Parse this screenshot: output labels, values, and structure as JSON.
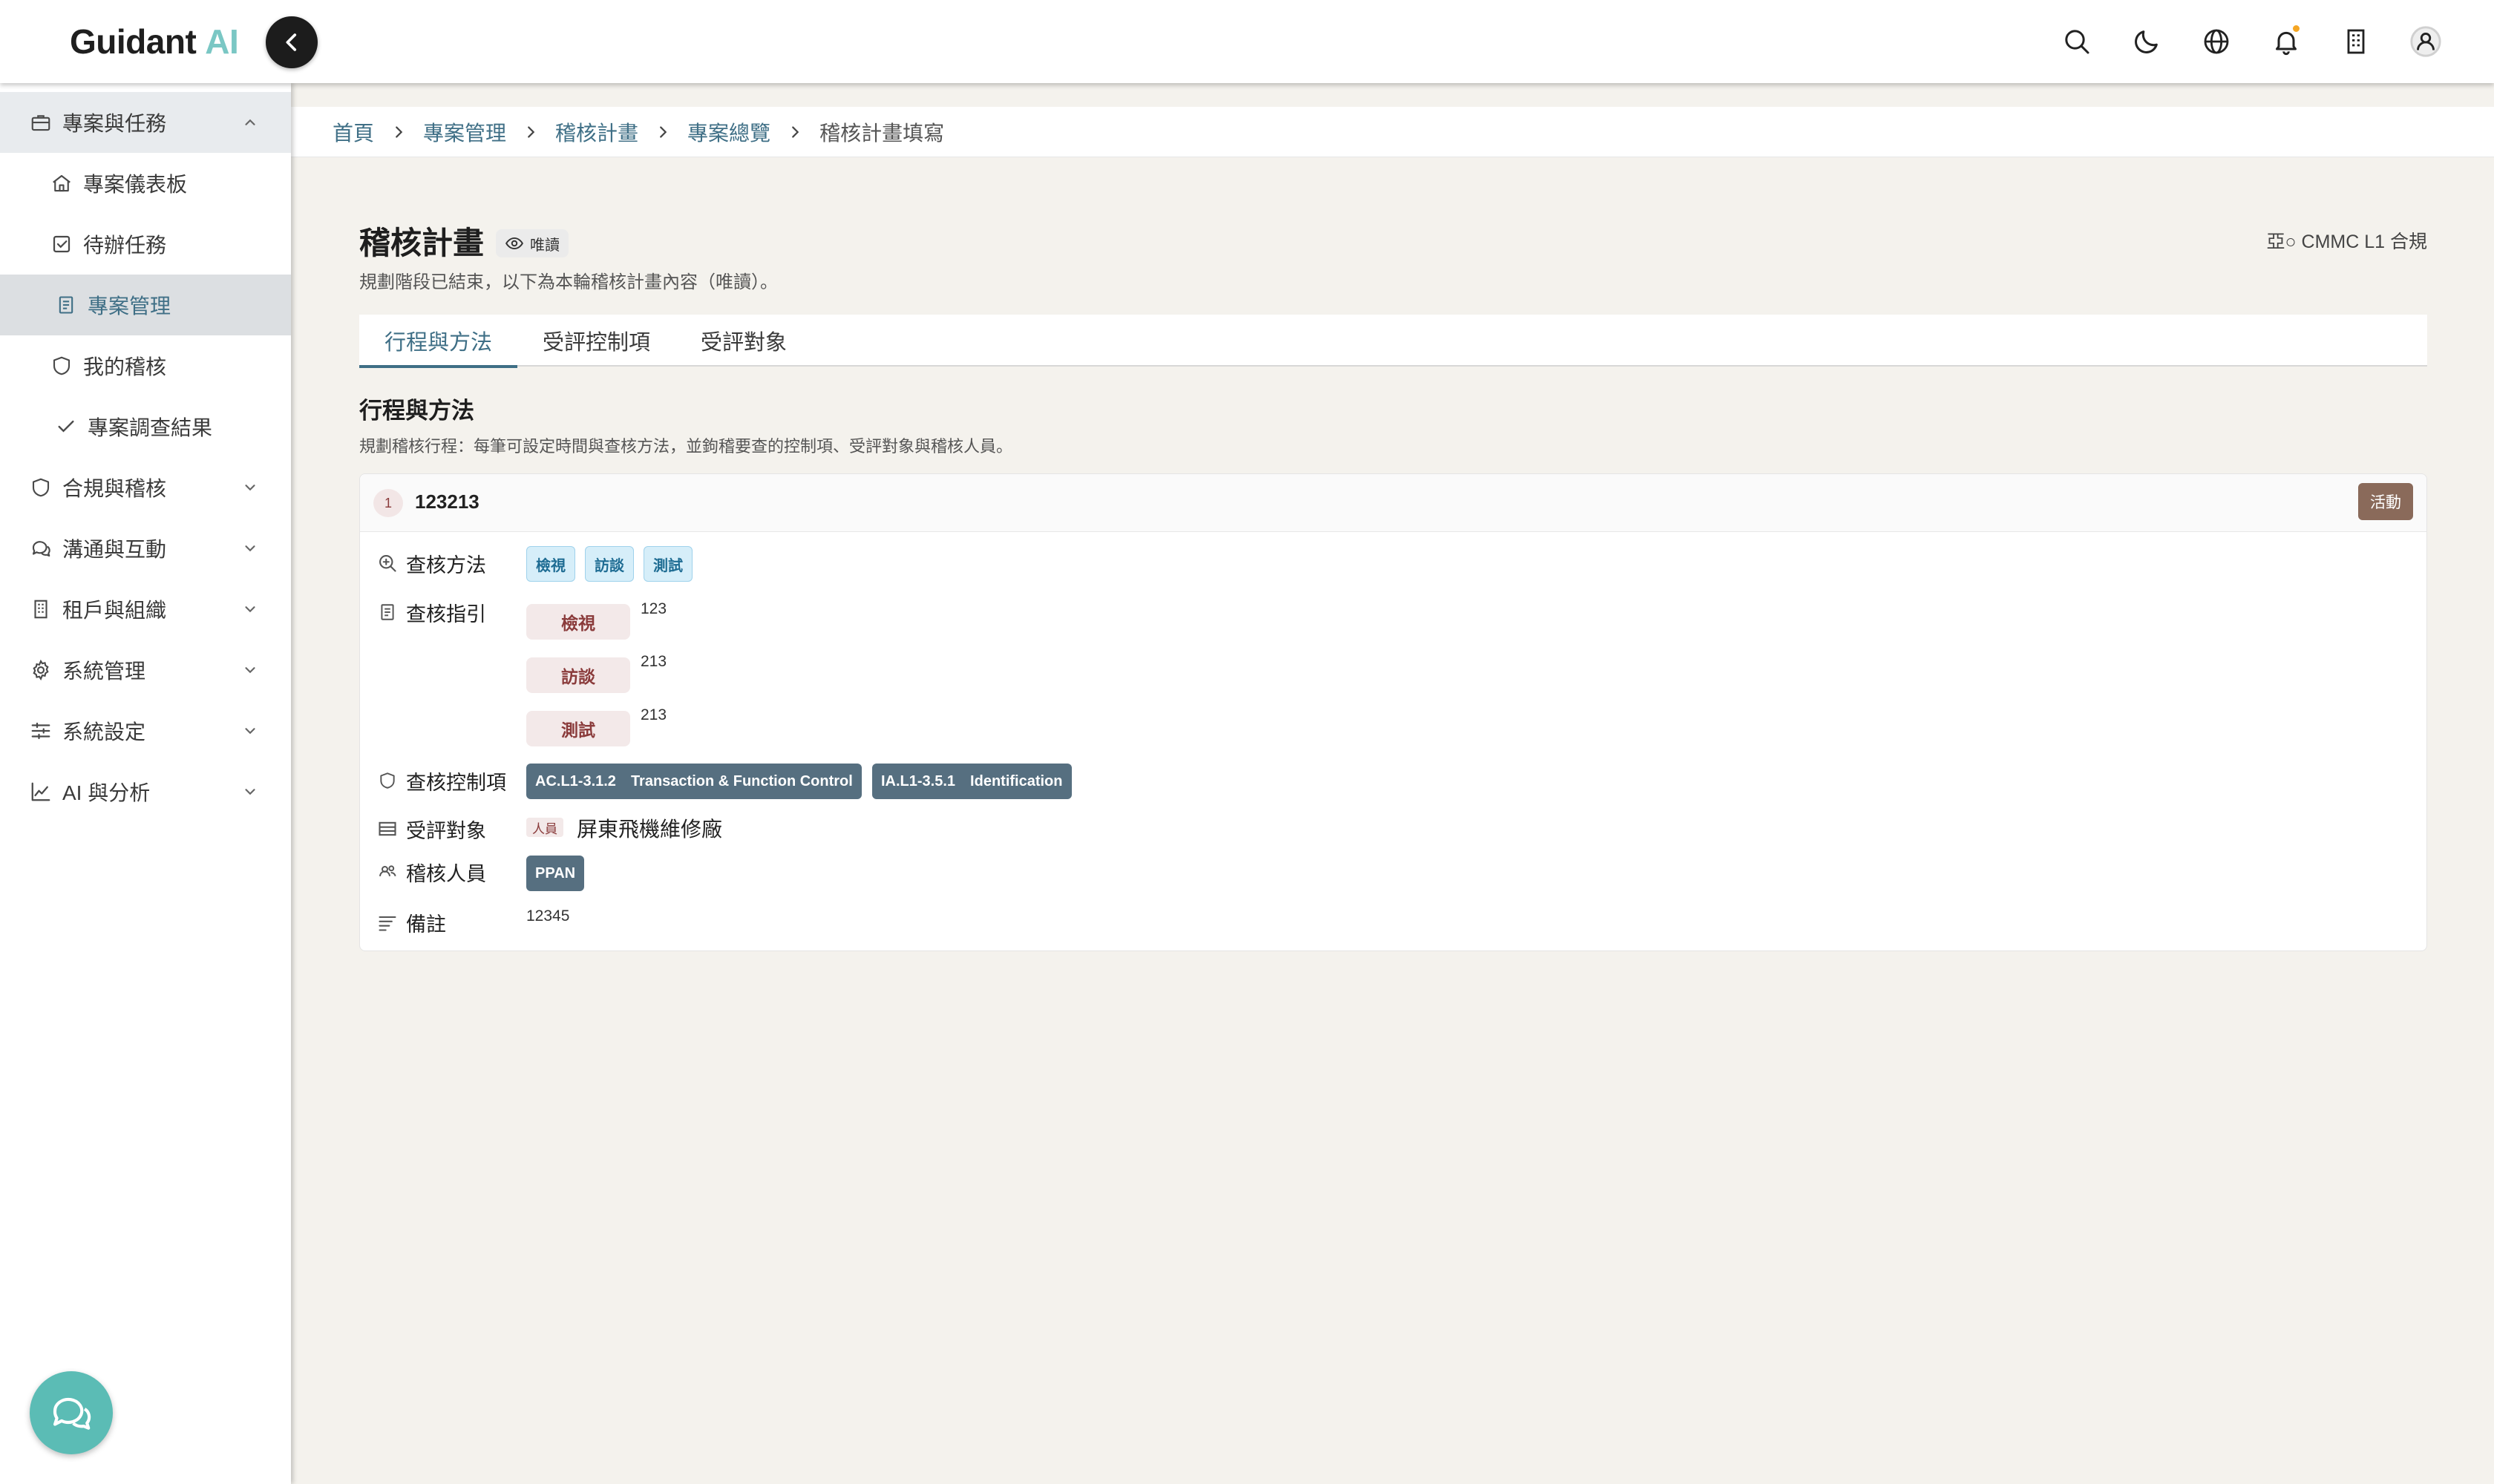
{
  "app": {
    "logo_text": "Guidant",
    "logo_accent": "AI",
    "accent_color": "#7ac7c4"
  },
  "topbar": {
    "icons": [
      "search-icon",
      "moon-icon",
      "globe-icon",
      "bell-icon",
      "building-icon",
      "user-icon"
    ],
    "has_notification": true
  },
  "sidebar": {
    "items": [
      {
        "label": "專案與任務",
        "icon": "briefcase-icon",
        "expanded": true
      },
      {
        "label": "專案儀表板",
        "icon": "home-icon"
      },
      {
        "label": "待辦任務",
        "icon": "checkbox-icon"
      },
      {
        "label": "專案管理",
        "icon": "document-icon",
        "active": true
      },
      {
        "label": "我的稽核",
        "icon": "shield-icon"
      },
      {
        "label": "專案調查結果",
        "icon": "check-icon"
      },
      {
        "label": "合規與稽核",
        "icon": "shield-icon",
        "expanded": false
      },
      {
        "label": "溝通與互動",
        "icon": "chat-icon",
        "expanded": false
      },
      {
        "label": "租戶與組織",
        "icon": "building-icon",
        "expanded": false
      },
      {
        "label": "系統管理",
        "icon": "gear-icon",
        "expanded": false
      },
      {
        "label": "系統設定",
        "icon": "sliders-icon",
        "expanded": false
      },
      {
        "label": "AI 與分析",
        "icon": "chart-icon",
        "expanded": false
      }
    ]
  },
  "breadcrumb": [
    "首頁",
    "專案管理",
    "稽核計畫",
    "專案總覽",
    "稽核計畫填寫"
  ],
  "page": {
    "title": "稽核計畫",
    "readonly_badge": "唯讀",
    "subtitle": "規劃階段已結束，以下為本輪稽核計畫內容（唯讀）。",
    "compliance_tag": "亞○ CMMC L1 合規"
  },
  "tabs": [
    {
      "label": "行程與方法",
      "active": true
    },
    {
      "label": "受評控制項",
      "active": false
    },
    {
      "label": "受評對象",
      "active": false
    }
  ],
  "section": {
    "title": "行程與方法",
    "description": "規劃稽核行程：每筆可設定時間與查核方法，並鉤稽要查的控制項、受評對象與稽核人員。"
  },
  "schedule_item": {
    "index": "1",
    "title": "123213",
    "status": "活動",
    "labels": {
      "methods": "查核方法",
      "guidance": "查核指引",
      "controls": "查核控制項",
      "targets": "受評對象",
      "auditors": "稽核人員",
      "notes": "備註"
    },
    "methods": [
      "檢視",
      "訪談",
      "測試"
    ],
    "guidance": [
      {
        "method": "檢視",
        "text": "123"
      },
      {
        "method": "訪談",
        "text": "213"
      },
      {
        "method": "測試",
        "text": "213"
      }
    ],
    "controls": [
      {
        "code": "AC.L1-3.1.2",
        "name": "Transaction & Function Control"
      },
      {
        "code": "IA.L1-3.5.1",
        "name": "Identification"
      }
    ],
    "target": {
      "type": "人員",
      "name": "屏東飛機維修廠"
    },
    "auditors": [
      "PPAN"
    ],
    "notes": "12345"
  }
}
